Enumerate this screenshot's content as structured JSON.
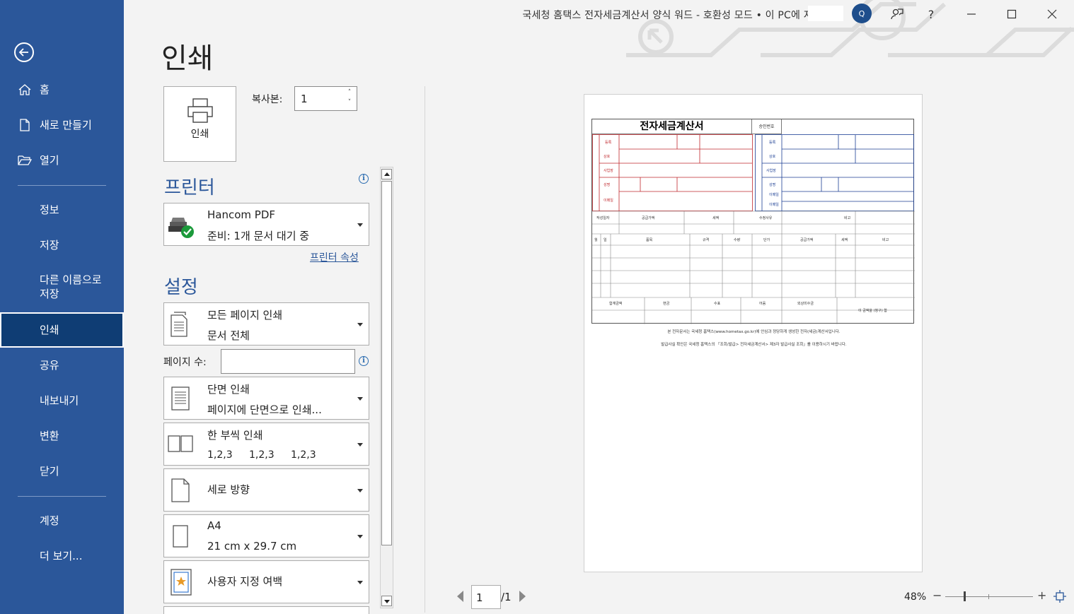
{
  "titlebar": {
    "document_title": "국세청 홈택스 전자세금계산서 양식 워드  -  호환성 모드 • 이 PC에 저장됨",
    "avatar_initial": "Q",
    "help": "?"
  },
  "sidebar": {
    "items": [
      {
        "label": "홈",
        "icon": "home-icon"
      },
      {
        "label": "새로 만들기",
        "icon": "new-document-icon"
      },
      {
        "label": "열기",
        "icon": "open-folder-icon"
      },
      {
        "label": "정보"
      },
      {
        "label": "저장"
      },
      {
        "label": "다른 이름으로\n저장"
      },
      {
        "label": "인쇄",
        "selected": true
      },
      {
        "label": "공유"
      },
      {
        "label": "내보내기"
      },
      {
        "label": "변환"
      },
      {
        "label": "닫기"
      },
      {
        "label": "계정"
      },
      {
        "label": "더 보기..."
      }
    ]
  },
  "print": {
    "heading": "인쇄",
    "print_button": "인쇄",
    "copies_label": "복사본:",
    "copies_value": "1",
    "printer_section": "프린터",
    "printer_name": "Hancom PDF",
    "printer_status": "준비: 1개 문서 대기 중",
    "printer_properties": "프린터 속성",
    "settings_section": "설정",
    "pages_setting": {
      "line1": "모든 페이지 인쇄",
      "line2": "문서 전체"
    },
    "pages_label": "페이지 수:",
    "pages_value": "",
    "sides_setting": {
      "line1": "단면 인쇄",
      "line2": "페이지에 단면으로 인쇄..."
    },
    "collate_setting": {
      "line1": "한 부씩 인쇄",
      "seq": [
        "1,2,3",
        "1,2,3",
        "1,2,3"
      ]
    },
    "orientation_setting": {
      "line1": "세로 방향"
    },
    "paper_setting": {
      "line1": "A4",
      "line2": "21 cm x 29.7 cm"
    },
    "margins_setting": {
      "line1": "사용자 지정 여백"
    }
  },
  "preview": {
    "invoice_title": "전자세금계산서",
    "approval_label": "승인번호",
    "note1": "본 전자문서는 국세청 홈택스(www.hometax.go.kr)에 안심과 정당하게 생성한 전자(세금)계산서입니다.",
    "note2": "발급사실 확인은 국세청 홈택스의 「조회/발급> 전자세금계산서> 제3자 발급사실 조회」를 이용하시기 바랍니다.",
    "current_page": "1",
    "total_pages": "/1",
    "zoom": "48%"
  },
  "colors": {
    "sidebar": "#2b579a",
    "sidebar_selected": "#0f3d74",
    "accent": "#2b579a",
    "supplier_red": "#c0282d",
    "buyer_blue": "#1c3f94"
  }
}
